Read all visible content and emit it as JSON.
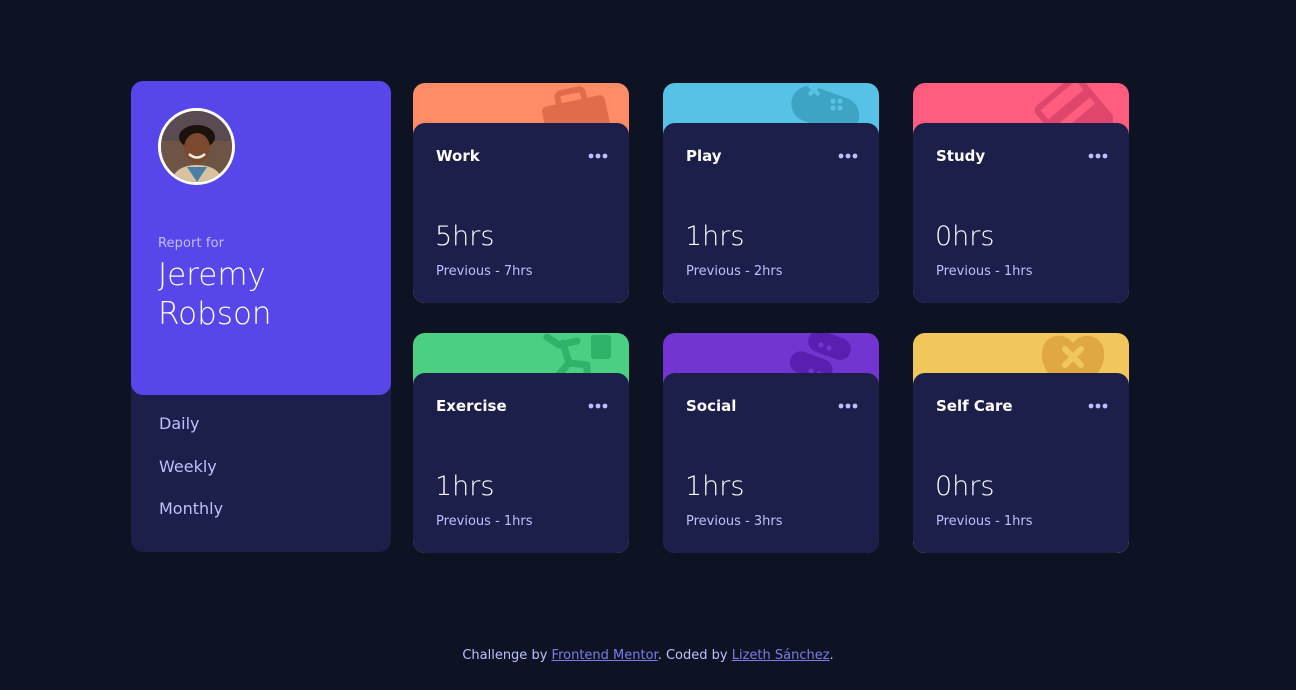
{
  "profile": {
    "report_label": "Report for",
    "name": "Jeremy Robson",
    "timeframes": [
      "Daily",
      "Weekly",
      "Monthly"
    ]
  },
  "cards": [
    {
      "title": "Work",
      "current": "5hrs",
      "previous": "Previous - 7hrs",
      "color": "#ff8c66",
      "icon": "briefcase-icon"
    },
    {
      "title": "Play",
      "current": "1hrs",
      "previous": "Previous - 2hrs",
      "color": "#56c2e6",
      "icon": "gamepad-icon"
    },
    {
      "title": "Study",
      "current": "0hrs",
      "previous": "Previous - 1hrs",
      "color": "#ff5d7f",
      "icon": "books-icon"
    },
    {
      "title": "Exercise",
      "current": "1hrs",
      "previous": "Previous - 1hrs",
      "color": "#4bcf83",
      "icon": "running-figure-icon"
    },
    {
      "title": "Social",
      "current": "1hrs",
      "previous": "Previous - 3hrs",
      "color": "#7335d2",
      "icon": "chat-bubble-icon"
    },
    {
      "title": "Self Care",
      "current": "0hrs",
      "previous": "Previous - 1hrs",
      "color": "#f1c75b",
      "icon": "heart-icon"
    }
  ],
  "footer": {
    "prefix": "Challenge by ",
    "link1": "Frontend Mentor",
    "middle": ". Coded by ",
    "link2": "Lizeth Sánchez",
    "suffix": "."
  },
  "colors": {
    "page_bg": "#0e1323",
    "card_bg": "#1c1f4a",
    "profile_accent": "#5746ea",
    "muted_text": "#bbc0ff"
  }
}
